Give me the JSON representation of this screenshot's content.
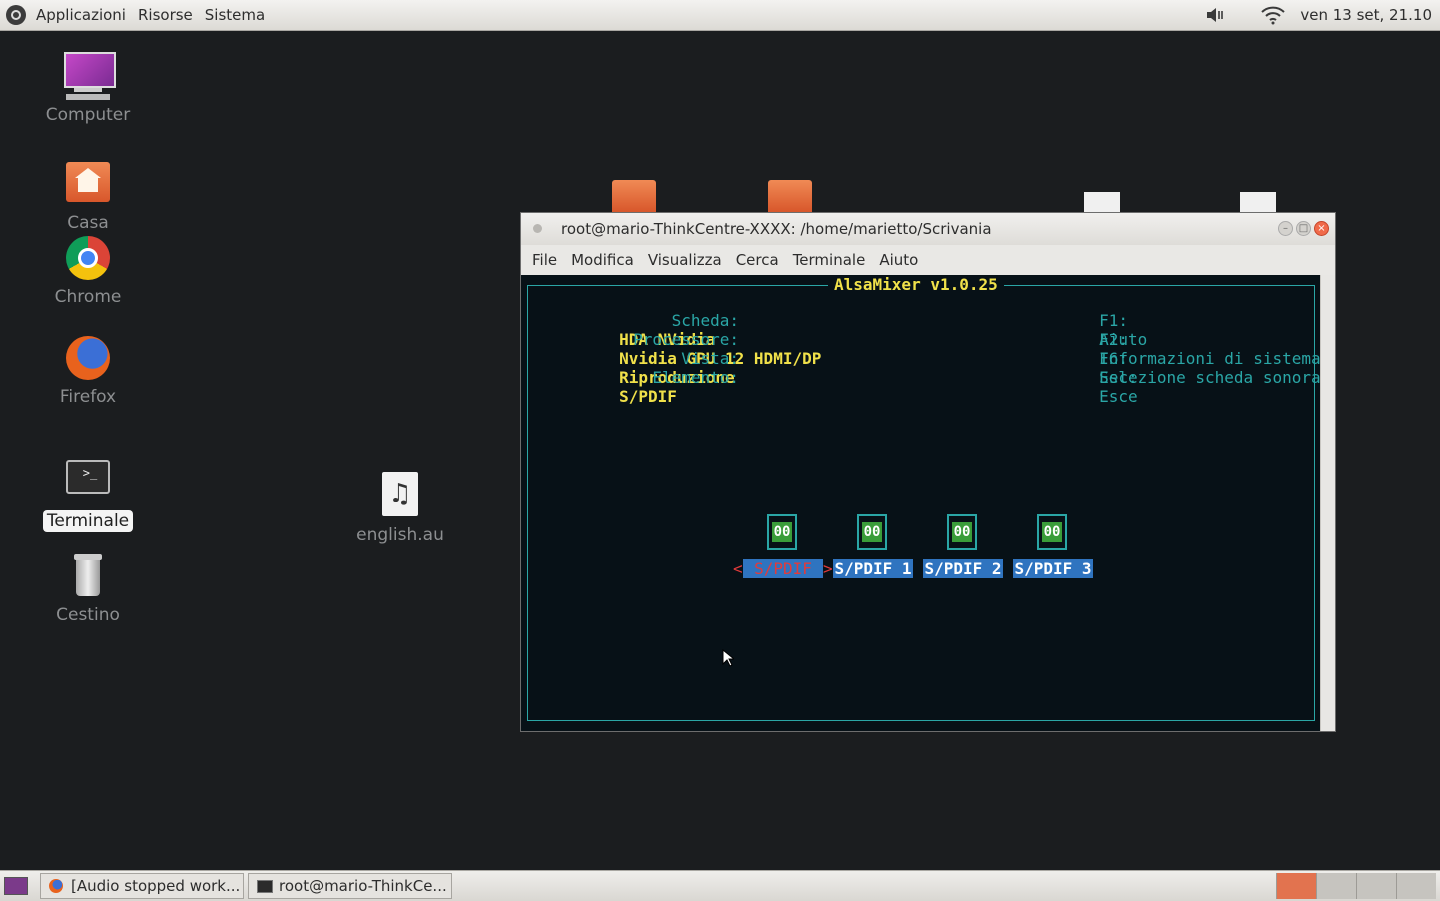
{
  "top_panel": {
    "menus": [
      "Applicazioni",
      "Risorse",
      "Sistema"
    ],
    "clock": "ven 13 set, 21.10",
    "tray_icons": [
      "volume-muted-icon",
      "wifi-icon"
    ]
  },
  "desktop": {
    "icons": [
      {
        "label": "Computer",
        "icon": "computer-icon"
      },
      {
        "label": "Casa",
        "icon": "home-folder-icon"
      },
      {
        "label": "Chrome",
        "icon": "chrome-icon"
      },
      {
        "label": "Firefox",
        "icon": "firefox-icon"
      },
      {
        "label": "Terminale",
        "icon": "terminal-icon",
        "selected": true
      },
      {
        "label": "Cestino",
        "icon": "trash-icon"
      },
      {
        "label": "english.au",
        "icon": "audio-file-icon"
      }
    ]
  },
  "terminal_window": {
    "title": "root@mario-ThinkCentre-XXXX: /home/marietto/Scrivania",
    "menu": [
      "File",
      "Modifica",
      "Visualizza",
      "Cerca",
      "Terminale",
      "Aiuto"
    ],
    "alsamixer": {
      "title": "AlsaMixer v1.0.25",
      "info": [
        {
          "key": "Scheda:",
          "value": "HDA NVidia"
        },
        {
          "key": "Processore:",
          "value": "Nvidia GPU 12 HDMI/DP"
        },
        {
          "key": "Vista:",
          "value": "Riproduzione"
        },
        {
          "key": "Elemento:",
          "value": "S/PDIF"
        }
      ],
      "help": [
        {
          "key": "F1:",
          "value": "Aiuto"
        },
        {
          "key": "F2:",
          "value": "Informazioni di sistema"
        },
        {
          "key": "F6:",
          "value": "Selezione scheda sonora"
        },
        {
          "key": "Esc:",
          "value": "Esce"
        }
      ],
      "controls": [
        {
          "label": "S/PDIF",
          "value": "00",
          "active": true
        },
        {
          "label": "S/PDIF 1",
          "value": "00"
        },
        {
          "label": "S/PDIF 2",
          "value": "00"
        },
        {
          "label": "S/PDIF 3",
          "value": "00"
        }
      ],
      "arrow_left": "<",
      "arrow_right": ">"
    }
  },
  "bottom_panel": {
    "tasks": [
      "[Audio stopped work...",
      "root@mario-ThinkCe..."
    ],
    "workspaces": 4,
    "active_workspace": 1
  },
  "colors": {
    "terminal_bg": "#071117",
    "cyan": "#2aa6a6",
    "yellow": "#f0e14a",
    "blue": "#2f74c0",
    "red": "#e23b3b",
    "green": "#3a9d3a",
    "accent": "#e2734f"
  }
}
